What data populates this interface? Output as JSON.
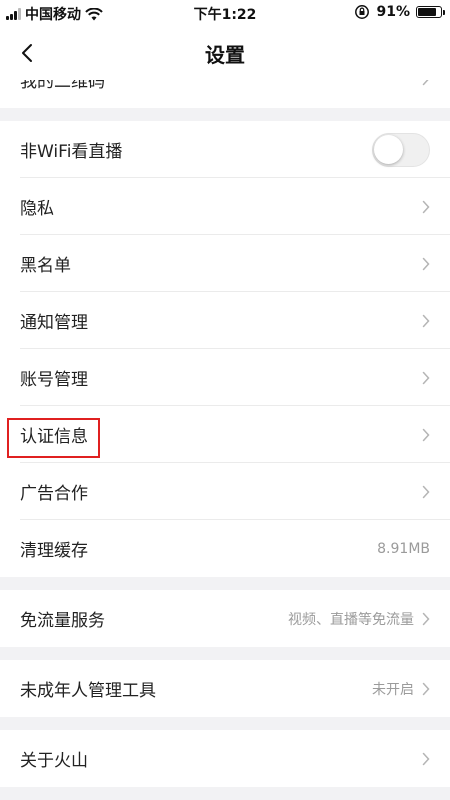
{
  "status_bar": {
    "carrier": "中国移动",
    "time": "下午1:22",
    "battery_percent_text": "91%",
    "battery_level": 0.91,
    "icons": [
      "signal-icon",
      "wifi-icon",
      "orientation-lock-icon",
      "battery-icon"
    ]
  },
  "nav": {
    "title": "设置",
    "back_icon": "chevron-left-icon"
  },
  "sections": [
    {
      "items": [
        {
          "label": "我的二维码",
          "icon": "chevron-right-icon"
        }
      ]
    },
    {
      "items": [
        {
          "label": "非WiFi看直播",
          "control": "toggle",
          "toggle_on": false
        },
        {
          "label": "隐私",
          "icon": "chevron-right-icon"
        },
        {
          "label": "黑名单",
          "icon": "chevron-right-icon"
        },
        {
          "label": "通知管理",
          "icon": "chevron-right-icon"
        },
        {
          "label": "账号管理",
          "icon": "chevron-right-icon"
        },
        {
          "label": "认证信息",
          "icon": "chevron-right-icon",
          "highlighted": true
        },
        {
          "label": "广告合作",
          "icon": "chevron-right-icon"
        },
        {
          "label": "清理缓存",
          "value": "8.91MB"
        }
      ]
    },
    {
      "items": [
        {
          "label": "免流量服务",
          "value": "视频、直播等免流量",
          "icon": "chevron-right-icon"
        }
      ]
    },
    {
      "items": [
        {
          "label": "未成年人管理工具",
          "value": "未开启",
          "icon": "chevron-right-icon"
        }
      ]
    },
    {
      "items": [
        {
          "label": "关于火山",
          "icon": "chevron-right-icon"
        }
      ]
    }
  ],
  "colors": {
    "background": "#f2f2f4",
    "row": "#ffffff",
    "text": "#222222",
    "secondary_text": "#9b9b9b",
    "highlight": "#e02020"
  }
}
